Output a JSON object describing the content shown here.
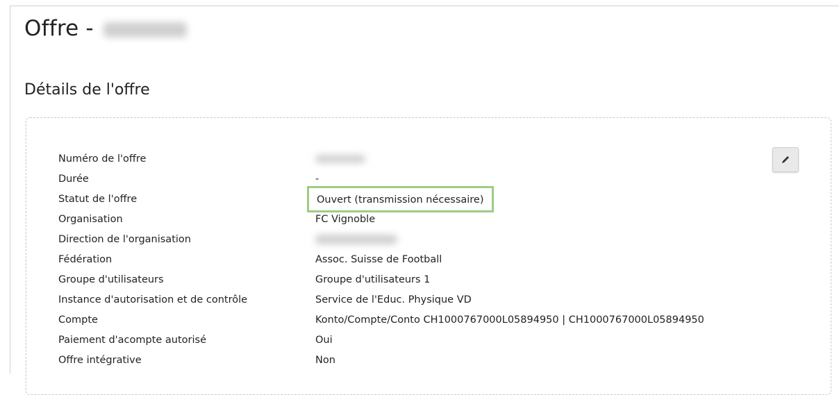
{
  "page": {
    "title": "Offre -",
    "section_title": "Détails de l'offre"
  },
  "details": [
    {
      "label": "Numéro de l'offre",
      "value": ""
    },
    {
      "label": "Durée",
      "value": "-"
    },
    {
      "label": "Statut de l'offre",
      "value": "Ouvert (transmission nécessaire)"
    },
    {
      "label": "Organisation",
      "value": "FC Vignoble"
    },
    {
      "label": "Direction de l'organisation",
      "value": ""
    },
    {
      "label": "Fédération",
      "value": "Assoc. Suisse de Football"
    },
    {
      "label": "Groupe d'utilisateurs",
      "value": "Groupe d'utilisateurs 1"
    },
    {
      "label": "Instance d'autorisation et de contrôle",
      "value": "Service de l'Educ. Physique VD"
    },
    {
      "label": "Compte",
      "value": "Konto/Compte/Conto CH1000767000L05894950 | CH1000767000L05894950"
    },
    {
      "label": "Paiement d'acompte autorisé",
      "value": "Oui"
    },
    {
      "label": "Offre intégrative",
      "value": "Non"
    }
  ],
  "icons": {
    "edit": "pencil-icon"
  },
  "colors": {
    "highlight": "#9ccc84"
  }
}
